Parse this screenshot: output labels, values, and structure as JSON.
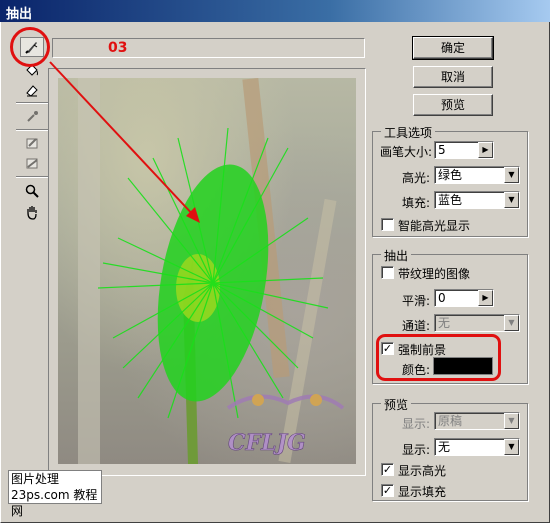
{
  "window": {
    "title": "抽出"
  },
  "step_label": "03",
  "tools": [
    {
      "name": "edge-highlighter-icon",
      "state": "active"
    },
    {
      "name": "fill-bucket-icon",
      "state": "normal"
    },
    {
      "name": "eraser-icon",
      "state": "normal"
    },
    {
      "name": "eyedropper-icon",
      "state": "disabled"
    },
    {
      "name": "cleanup-tool-icon",
      "state": "disabled"
    },
    {
      "name": "edge-touchup-icon",
      "state": "disabled"
    },
    {
      "name": "zoom-icon",
      "state": "normal"
    },
    {
      "name": "hand-icon",
      "state": "normal"
    }
  ],
  "buttons": {
    "ok": "确定",
    "cancel": "取消",
    "preview": "预览"
  },
  "tool_options": {
    "title": "工具选项",
    "brush_size_label": "画笔大小:",
    "brush_size_value": "5",
    "highlight_label": "高光:",
    "highlight_value": "绿色",
    "fill_label": "填充:",
    "fill_value": "蓝色",
    "smart_highlight_label": "智能高光显示",
    "smart_highlight_checked": false
  },
  "extraction": {
    "title": "抽出",
    "textured_label": "带纹理的图像",
    "textured_checked": false,
    "smooth_label": "平滑:",
    "smooth_value": "0",
    "channel_label": "通道:",
    "channel_value": "无",
    "force_fg_label": "强制前景",
    "force_fg_checked": true,
    "color_label": "颜色:",
    "color_value": "#000000"
  },
  "preview": {
    "title": "预览",
    "show_label": "显示:",
    "show_value": "原稿",
    "display_label": "显示:",
    "display_value": "无",
    "show_highlight_label": "显示高光",
    "show_highlight_checked": true,
    "show_fill_label": "显示填充",
    "show_fill_checked": true
  },
  "watermark": {
    "line1": "图片处理",
    "line2": "23ps.com",
    "line3": "教程网",
    "logo_text": "CFLJG"
  },
  "colors": {
    "highlight": "#19e01a",
    "annotation": "#e01010"
  }
}
